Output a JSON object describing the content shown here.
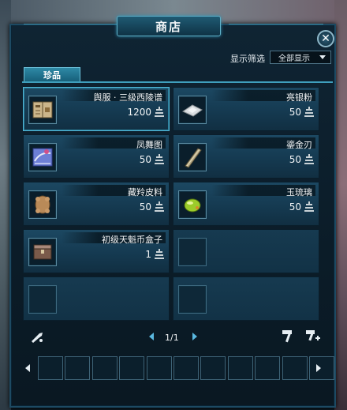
{
  "window": {
    "title": "商店",
    "close": "✕"
  },
  "filter": {
    "label": "显示筛选",
    "selected": "全部显示"
  },
  "tabs": [
    {
      "label": "珍品",
      "active": true
    }
  ],
  "items": [
    {
      "name": "舆服 · 三级西陵谱",
      "price": "1200",
      "icon": "scroll-book-icon"
    },
    {
      "name": "亮银粉",
      "price": "50",
      "icon": "silver-powder-icon"
    },
    {
      "name": "凤舞图",
      "price": "50",
      "icon": "phoenix-painting-icon"
    },
    {
      "name": "鎏金刃",
      "price": "50",
      "icon": "gilded-blade-icon"
    },
    {
      "name": "藏羚皮料",
      "price": "50",
      "icon": "antelope-hide-icon"
    },
    {
      "name": "玉琉璃",
      "price": "50",
      "icon": "jade-glass-icon"
    },
    {
      "name": "初级天魁币盒子",
      "price": "1",
      "icon": "coin-box-icon"
    }
  ],
  "pagination": {
    "text": "1/1"
  },
  "colors": {
    "accent": "#3f9fbd",
    "panel": "#153a51",
    "nav_arrow": "#5ab8e0"
  },
  "inventory": {
    "slot_count": 11
  }
}
